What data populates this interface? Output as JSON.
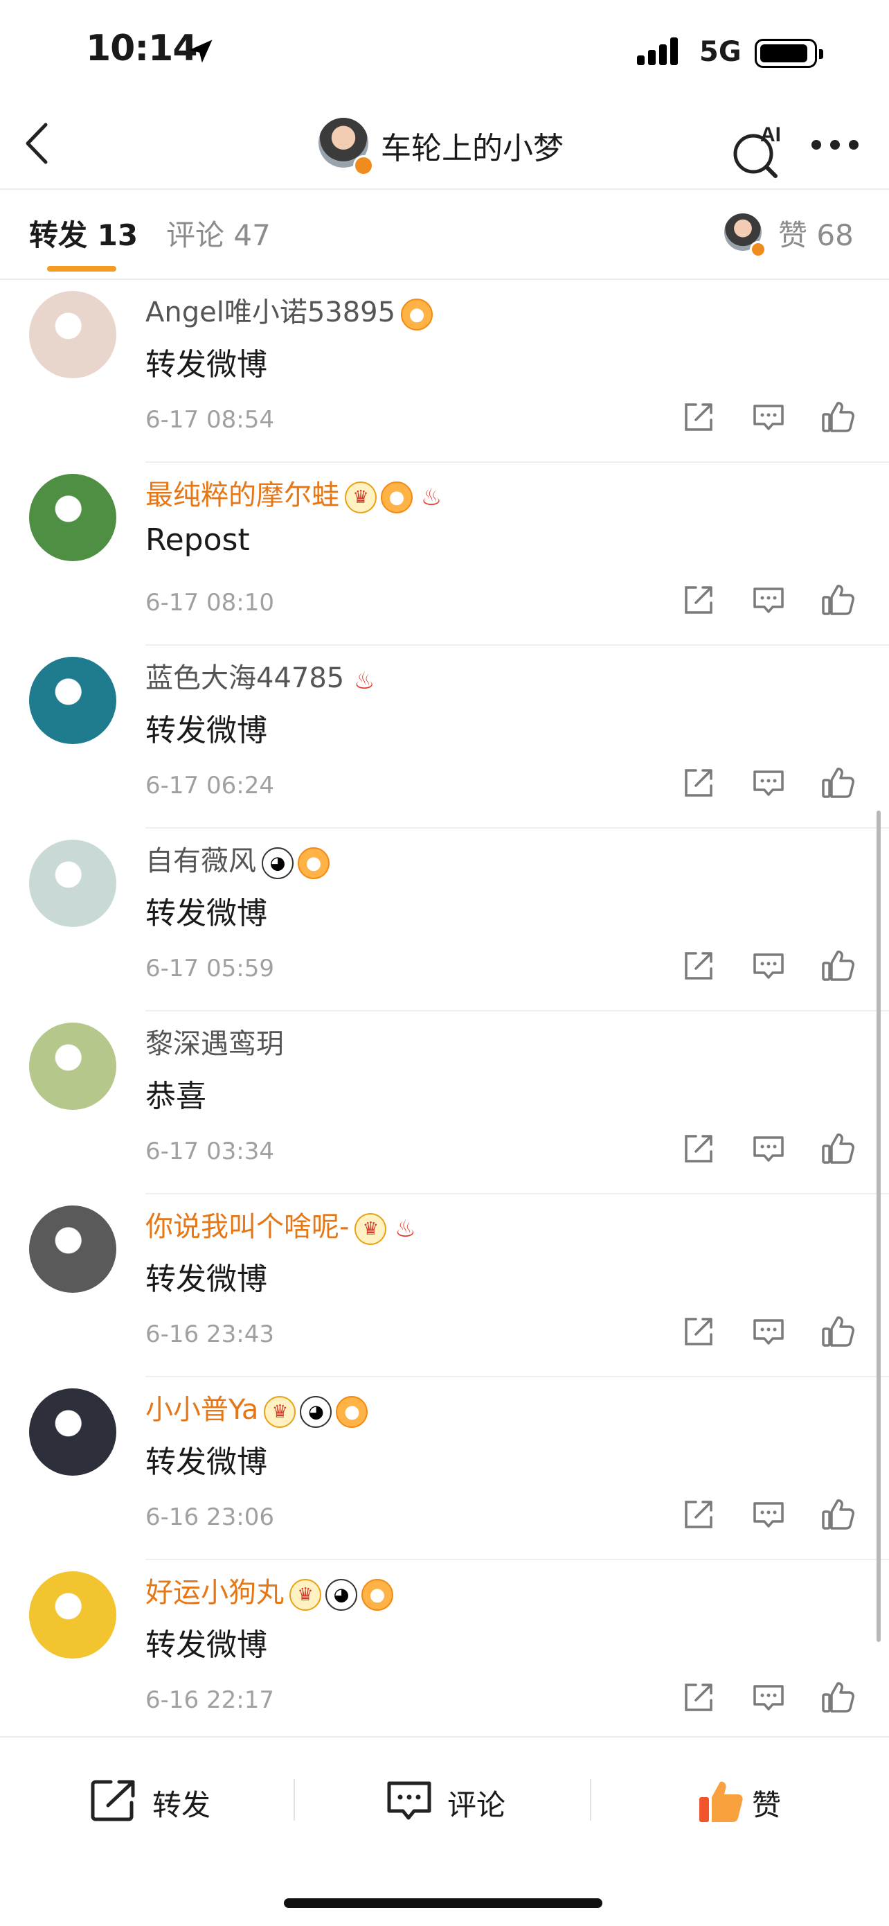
{
  "status_bar": {
    "time": "10:14",
    "network": "5G"
  },
  "header": {
    "title": "车轮上的小梦"
  },
  "tabs": {
    "repost": "转发 13",
    "comment": "评论 47",
    "likes": "赞 68"
  },
  "reposts": [
    {
      "name": "Angel唯小诺53895",
      "vip": false,
      "badges": [
        "fish"
      ],
      "text": "转发微博",
      "time": "6-17 08:54",
      "avatar_color": "#e8d6cc"
    },
    {
      "name": "最纯粹的摩尔蛙",
      "vip": true,
      "badges": [
        "crown",
        "fish",
        "fire"
      ],
      "text": "Repost",
      "time": "6-17 08:10",
      "avatar_color": "#4e8f44"
    },
    {
      "name": "蓝色大海44785",
      "vip": false,
      "badges": [
        "fire"
      ],
      "text": "转发微博",
      "time": "6-17 06:24",
      "avatar_color": "#1f7b8e"
    },
    {
      "name": "自有薇风",
      "vip": false,
      "badges": [
        "panda",
        "fish"
      ],
      "text": "转发微博",
      "time": "6-17 05:59",
      "avatar_color": "#c9d9d6"
    },
    {
      "name": "黎深遇鸾玥",
      "vip": false,
      "badges": [],
      "text": "恭喜",
      "time": "6-17 03:34",
      "avatar_color": "#b5c78a"
    },
    {
      "name": "你说我叫个啥呢-",
      "vip": true,
      "badges": [
        "crown",
        "fire"
      ],
      "text": "转发微博",
      "time": "6-16 23:43",
      "avatar_color": "#5a5a5a"
    },
    {
      "name": "小小普Ya",
      "vip": true,
      "badges": [
        "crown",
        "panda",
        "fish"
      ],
      "text": "转发微博",
      "time": "6-16 23:06",
      "avatar_color": "#2d2f3a"
    },
    {
      "name": "好运小狗丸",
      "vip": true,
      "badges": [
        "crown",
        "panda",
        "fish"
      ],
      "text": "转发微博",
      "time": "6-16 22:17",
      "avatar_color": "#f2c530"
    }
  ],
  "bottom_bar": {
    "repost_label": "转发",
    "comment_label": "评论",
    "like_label": "赞"
  },
  "colors": {
    "accent": "#f59b22",
    "vip_name": "#e67716",
    "like_active": "#f2552b"
  },
  "badge_icons": {
    "crown": "crown-badge-icon",
    "fish": "fish-badge-icon",
    "panda": "panda-badge-icon",
    "fire": "fire-badge-icon"
  }
}
